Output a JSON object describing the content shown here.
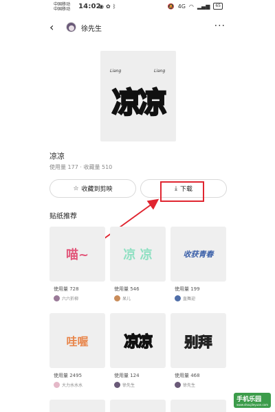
{
  "status_bar": {
    "carrier_1": "中国移动",
    "carrier_2": "中国移动",
    "time": "14:02",
    "network": "4G",
    "battery": "65"
  },
  "header": {
    "username": "徐先生"
  },
  "sticker": {
    "big_text": "凉凉",
    "tag": "Liang",
    "title": "凉凉",
    "stats": "使用量 177 · 收藏量 510"
  },
  "actions": {
    "favorite_label": "收藏到剪映",
    "download_label": "下载"
  },
  "recommend": {
    "section_title": "贴纸推荐",
    "cards": [
      {
        "art": "喵~",
        "usage": "使用量 728",
        "author": "六六折柳",
        "art_color": "#e2577a",
        "avatar_color": "#9a7a98"
      },
      {
        "art": "凉 凉",
        "usage": "使用量 546",
        "author": "呆儿",
        "art_color": "#8fe0c2",
        "avatar_color": "#c98c5a"
      },
      {
        "art": "收获青春",
        "usage": "使用量 199",
        "author": "直舞迎",
        "art_color": "#3a5fa8",
        "avatar_color": "#4f6ea8"
      },
      {
        "art": "哇喔",
        "usage": "使用量 2495",
        "author": "大力水水水",
        "art_color": "#e8854a",
        "avatar_color": "#e4b8c8"
      },
      {
        "art": "凉凉",
        "usage": "使用量 124",
        "author": "徐先生",
        "art_color": "#ffffff",
        "avatar_color": "#6a5a78"
      },
      {
        "art": "别拜",
        "usage": "使用量 468",
        "author": "徐先生",
        "art_color": "#ff6a9a",
        "avatar_color": "#6a5a78"
      }
    ]
  },
  "watermark": {
    "brand": "手机乐园",
    "url": "www.shoujileyuan.com"
  },
  "colors": {
    "highlight": "#e0242f",
    "preview_bg": "#eeeeee"
  }
}
